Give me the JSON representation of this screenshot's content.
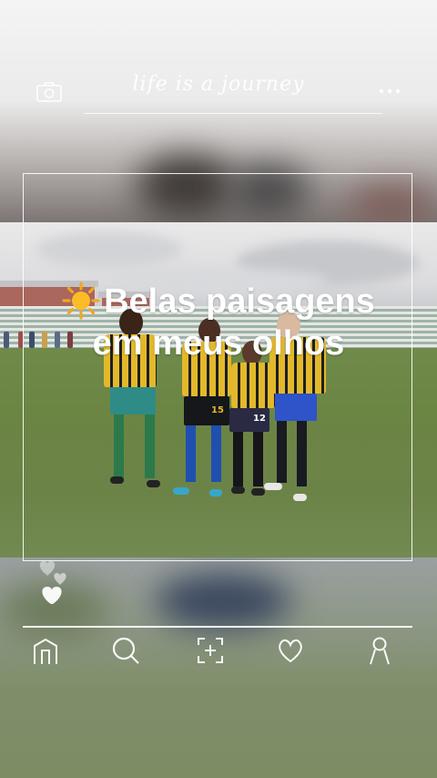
{
  "header": {
    "brand_text": "life is a journey",
    "left_icon": "camera-icon",
    "right_icon": "more-dots-icon"
  },
  "photo": {
    "jersey_numbers": [
      "15",
      "12"
    ]
  },
  "caption": {
    "emoji_icon": "sun-icon",
    "text": "Belas paisagens em meus olhos"
  },
  "reactions": {
    "icon": "hearts-icon"
  },
  "nav": {
    "items": [
      {
        "icon": "home-icon"
      },
      {
        "icon": "search-icon"
      },
      {
        "icon": "add-icon"
      },
      {
        "icon": "heart-icon"
      },
      {
        "icon": "profile-icon"
      }
    ]
  },
  "colors": {
    "overlay": "#ffffff",
    "jersey_yellow": "#e3b92b",
    "field_green": "#6b8543"
  }
}
